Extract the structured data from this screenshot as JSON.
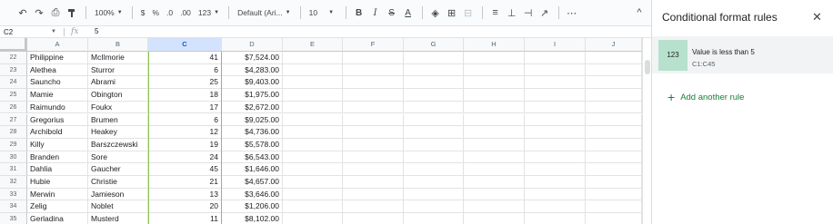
{
  "toolbar": {
    "zoom": "100%",
    "currency": "$",
    "percent": "%",
    "dec_less": ".0",
    "dec_more": ".00",
    "format_more": "123",
    "font": "Default (Ari...",
    "font_size": "10",
    "bold": "B",
    "italic": "I",
    "strike": "S",
    "text_color": "A",
    "more": "⋯",
    "collapse": "^"
  },
  "formula_bar": {
    "cell_ref": "C2",
    "fx": "fx",
    "value": "5"
  },
  "columns": [
    "A",
    "B",
    "C",
    "D",
    "E",
    "F",
    "G",
    "H",
    "I",
    "J"
  ],
  "rows": [
    {
      "n": "22",
      "first": "Philippine",
      "last": "McIlmorie",
      "qty": "41",
      "amount": "$7,524.00"
    },
    {
      "n": "23",
      "first": "Alethea",
      "last": "Sturror",
      "qty": "6",
      "amount": "$4,283.00"
    },
    {
      "n": "24",
      "first": "Sauncho",
      "last": "Abrami",
      "qty": "25",
      "amount": "$9,403.00"
    },
    {
      "n": "25",
      "first": "Mamie",
      "last": "Obington",
      "qty": "18",
      "amount": "$1,975.00"
    },
    {
      "n": "26",
      "first": "Raimundo",
      "last": "Foukx",
      "qty": "17",
      "amount": "$2,672.00"
    },
    {
      "n": "27",
      "first": "Gregorius",
      "last": "Brumen",
      "qty": "6",
      "amount": "$9,025.00"
    },
    {
      "n": "28",
      "first": "Archibold",
      "last": "Heakey",
      "qty": "12",
      "amount": "$4,736.00"
    },
    {
      "n": "29",
      "first": "Killy",
      "last": "Barszczewski",
      "qty": "19",
      "amount": "$5,578.00"
    },
    {
      "n": "30",
      "first": "Branden",
      "last": "Sore",
      "qty": "24",
      "amount": "$6,543.00"
    },
    {
      "n": "31",
      "first": "Dahlia",
      "last": "Gaucher",
      "qty": "45",
      "amount": "$1,646.00"
    },
    {
      "n": "32",
      "first": "Hubie",
      "last": "Christie",
      "qty": "21",
      "amount": "$4,657.00"
    },
    {
      "n": "33",
      "first": "Merwin",
      "last": "Jamieson",
      "qty": "13",
      "amount": "$3,646.00"
    },
    {
      "n": "34",
      "first": "Zelig",
      "last": "Noblet",
      "qty": "20",
      "amount": "$1,206.00"
    },
    {
      "n": "35",
      "first": "Gerladina",
      "last": "Musterd",
      "qty": "11",
      "amount": "$8,102.00"
    }
  ],
  "panel": {
    "title": "Conditional format rules",
    "rule": {
      "preview": "123",
      "condition": "Value is less than 5",
      "range": "C1:C45",
      "fill_color": "#b7e1cd"
    },
    "add_rule": "Add another rule",
    "accent_color": "#188038"
  }
}
